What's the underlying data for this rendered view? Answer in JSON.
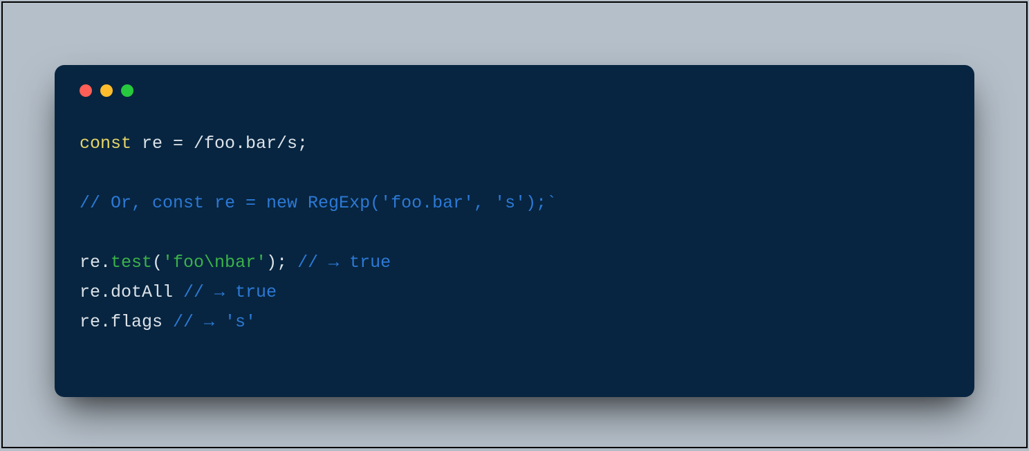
{
  "colors": {
    "page_bg": "#b5bfc9",
    "window_bg": "#072540",
    "keyword": "#e6d568",
    "plain": "#dce3ea",
    "comment": "#2d79d6",
    "string": "#3bb24a",
    "traffic_red": "#ff5f56",
    "traffic_yellow": "#ffbd2e",
    "traffic_green": "#27c93f"
  },
  "code": {
    "line1": {
      "keyword": "const",
      "rest": " re = /foo.bar/s;"
    },
    "line2": "",
    "line3": {
      "comment": "// Or, const re = new RegExp('foo.bar', 's');`"
    },
    "line4": "",
    "line5": {
      "pre": "re.",
      "method": "test",
      "open": "(",
      "string": "'foo\\nbar'",
      "close": "); ",
      "comment": "// → true"
    },
    "line6": {
      "pre": "re.dotAll ",
      "comment": "// → true"
    },
    "line7": {
      "pre": "re.flags ",
      "comment": "// → 's'"
    }
  }
}
